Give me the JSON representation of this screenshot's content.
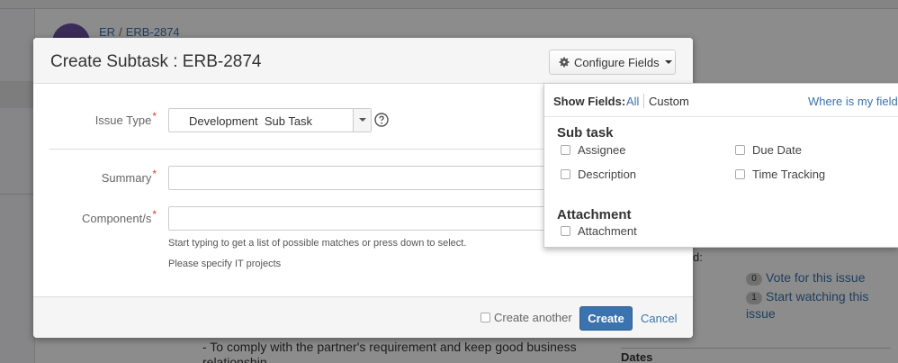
{
  "background": {
    "breadcrumb_project": "ER",
    "breadcrumb_sep": "/",
    "breadcrumb_issue": "ERB-2874",
    "description_text": "- To comply with the partner's requirement and keep good business relationship",
    "side_label_fragment": "d:",
    "vote_count": "0",
    "vote_label": "Vote for this issue",
    "watch_count": "1",
    "watch_label": "Start watching this issue",
    "dates_heading": "Dates"
  },
  "dialog": {
    "title": "Create Subtask : ERB-2874",
    "configure_fields_label": "Configure Fields",
    "issue_type": {
      "label": "Issue Type",
      "required_mark": "*",
      "value": "Development  Sub Task"
    },
    "summary": {
      "label": "Summary",
      "required_mark": "*",
      "value": ""
    },
    "components": {
      "label": "Component/s",
      "required_mark": "*",
      "value": "",
      "hint": "Start typing to get a list of possible matches or press down to select.",
      "hint2": "Please specify IT projects"
    },
    "footer": {
      "create_another_label": "Create another",
      "create_another_checked": false,
      "create_label": "Create",
      "cancel_label": "Cancel"
    }
  },
  "configure_popup": {
    "show_fields_label": "Show Fields:",
    "all_label": "All",
    "custom_label": "Custom",
    "where_label": "Where is my field?",
    "sections": [
      {
        "title": "Sub task",
        "fields": [
          {
            "label": "Assignee",
            "checked": false
          },
          {
            "label": "Due Date",
            "checked": false
          },
          {
            "label": "Description",
            "checked": false
          },
          {
            "label": "Time Tracking",
            "checked": false
          }
        ]
      },
      {
        "title": "Attachment",
        "fields": [
          {
            "label": "Attachment",
            "checked": false
          }
        ]
      }
    ]
  },
  "colors": {
    "link": "#3b73af",
    "primary_button": "#3b73af",
    "required": "#d04437"
  }
}
